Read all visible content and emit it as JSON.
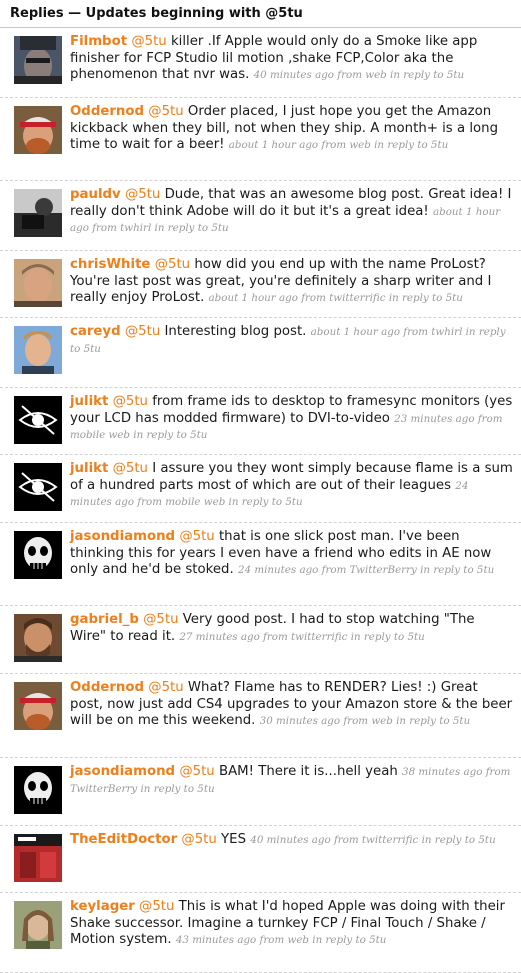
{
  "header": {
    "title": "Replies — Updates beginning with @5tu"
  },
  "mention_name": "@5tu",
  "replies": [
    {
      "user": "Filmbot",
      "text": " killer .If Apple would only do a Smoke like app finisher for FCP Studio lil motion ,shake FCP,Color aka the phenomenon that nvr was.",
      "meta": "40 minutes ago from web in reply to 5tu"
    },
    {
      "user": "Oddernod",
      "text": " Order placed, I just hope you get the Amazon kickback when they bill, not when they ship. A month+ is a long time to wait for a beer!",
      "meta": "about 1 hour ago from web in reply to 5tu"
    },
    {
      "user": "pauldv",
      "text": " Dude, that was an awesome blog post. Great idea! I really don't think Adobe will do it but it's a great idea!",
      "meta": "about 1 hour ago from twhirl in reply to 5tu"
    },
    {
      "user": "chrisWhite",
      "text": " how did you end up with the name ProLost? You're last post was great, you're definitely a sharp writer and I really enjoy ProLost.",
      "meta": "about 1 hour ago from twitterrific in reply to 5tu"
    },
    {
      "user": "careyd",
      "text": " Interesting blog post.",
      "meta": "about 1 hour ago from twhirl in reply to 5tu"
    },
    {
      "user": "julikt",
      "text": " from frame ids to desktop to framesync monitors (yes your LCD has modded firmware) to DVI-to-video",
      "meta": "23 minutes ago from mobile web in reply to 5tu"
    },
    {
      "user": "julikt",
      "text": " I assure you they wont simply because flame is a sum of a hundred parts most of which are out of their leagues",
      "meta": "24 minutes ago from mobile web in reply to 5tu"
    },
    {
      "user": "jasondiamond",
      "text": " that is one slick post man. I've been thinking this for years I even have a friend who edits in AE now only and he'd be stoked.",
      "meta": "24 minutes ago from TwitterBerry in reply to 5tu"
    },
    {
      "user": "gabriel_b",
      "text": " Very good post. I had to stop watching \"The Wire\" to read it.",
      "meta": "27 minutes ago from twitterrific in reply to 5tu"
    },
    {
      "user": "Oddernod",
      "text": " What? Flame has to RENDER? Lies! :) Great post, now just add CS4 upgrades to your Amazon store & the beer will be on me this weekend.",
      "meta": "30 minutes ago from web in reply to 5tu"
    },
    {
      "user": "jasondiamond",
      "text": " BAM! There it is...hell yeah",
      "meta": "38 minutes ago from TwitterBerry in reply to 5tu"
    },
    {
      "user": "TheEditDoctor",
      "text": " YES",
      "meta": "40 minutes ago from twitterrific in reply to 5tu"
    },
    {
      "user": "keylager",
      "text": " This is what I'd hoped Apple was doing with their Shake successor. Imagine a turnkey FCP / Final Touch / Shake / Motion system.",
      "meta": "43 minutes ago from web in reply to 5tu"
    }
  ],
  "colors": {
    "link": "#ef7f1a",
    "meta": "#9a9a9a",
    "divider": "#d2d2d2"
  }
}
